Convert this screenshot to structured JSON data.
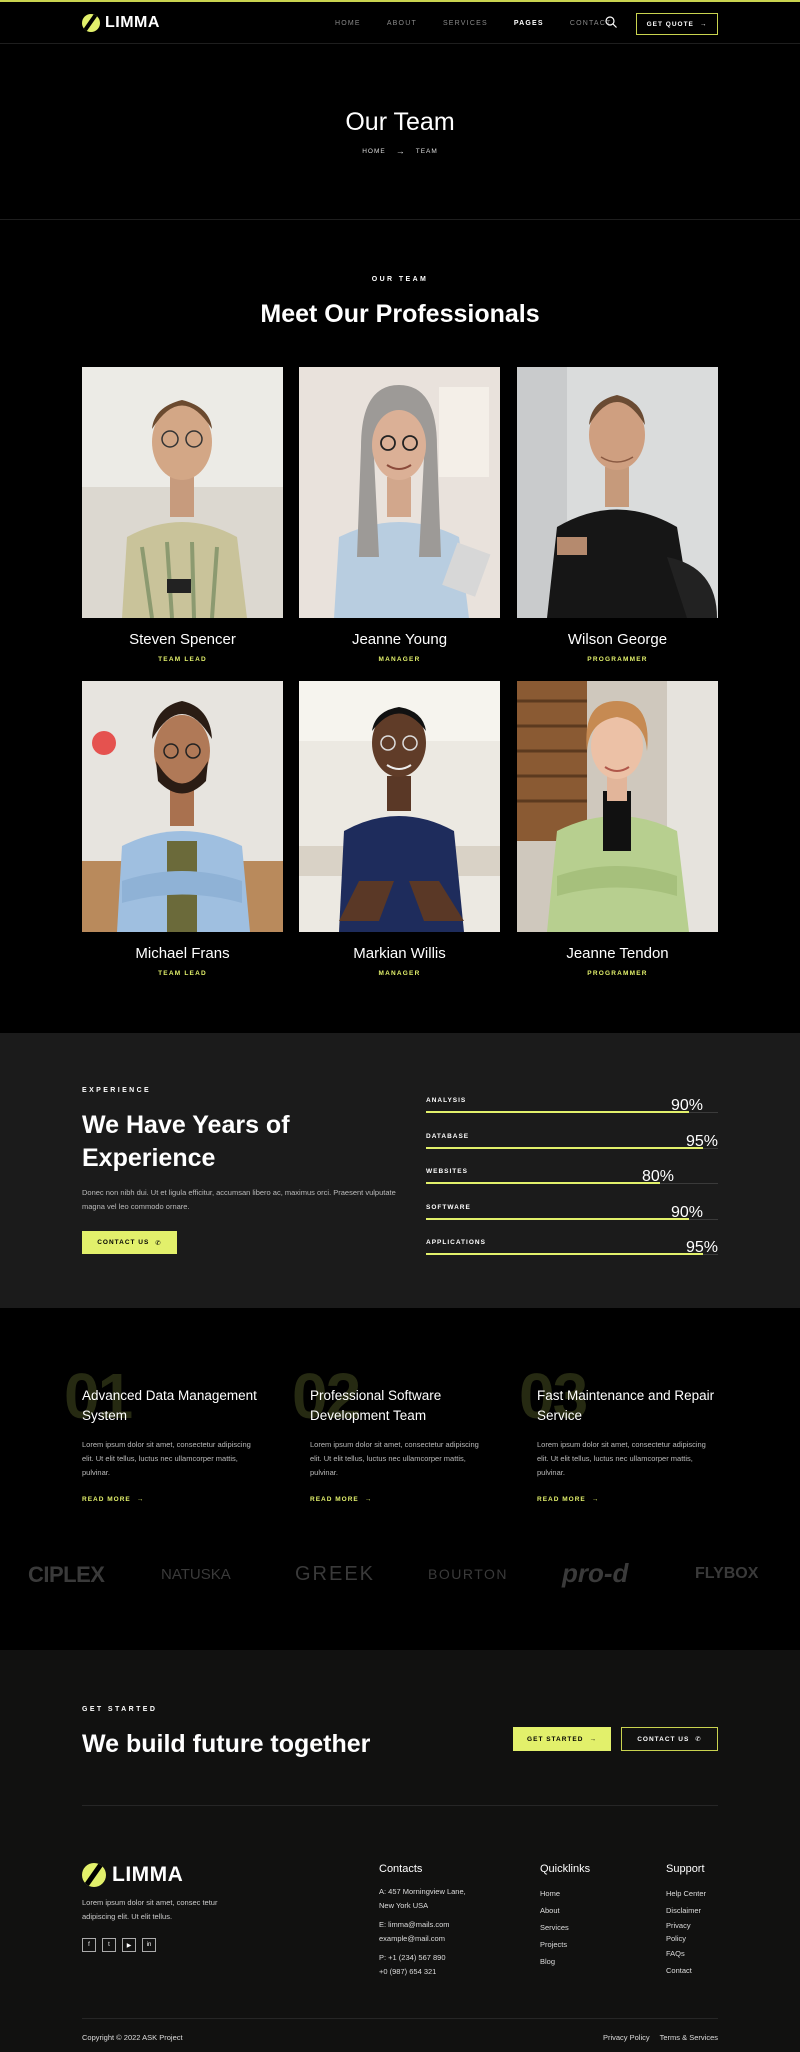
{
  "brand": {
    "name": "LIMMA",
    "accent": "#e2f06b"
  },
  "nav": {
    "items": [
      "HOME",
      "ABOUT",
      "SERVICES",
      "PAGES",
      "CONTACT"
    ],
    "active": "PAGES",
    "quote_label": "GET QUOTE"
  },
  "hero": {
    "title": "Our Team",
    "breadcrumb": [
      "HOME",
      "TEAM"
    ]
  },
  "team": {
    "eyebrow": "OUR TEAM",
    "title": "Meet Our Professionals",
    "members": [
      {
        "name": "Steven Spencer",
        "role": "TEAM LEAD"
      },
      {
        "name": "Jeanne Young",
        "role": "MANAGER"
      },
      {
        "name": "Wilson George",
        "role": "PROGRAMMER"
      },
      {
        "name": "Michael Frans",
        "role": "TEAM LEAD"
      },
      {
        "name": "Markian Willis",
        "role": "MANAGER"
      },
      {
        "name": "Jeanne Tendon",
        "role": "PROGRAMMER"
      }
    ]
  },
  "experience": {
    "eyebrow": "EXPERIENCE",
    "title": "We Have Years of Experience",
    "text": "Donec non nibh dui. Ut et ligula efficitur, accumsan libero ac, maximus orci. Praesent vulputate magna vel leo commodo ornare.",
    "button": "CONTACT US",
    "skills": [
      {
        "label": "ANALYSIS",
        "pct": "90%",
        "value": 90
      },
      {
        "label": "DATABASE",
        "pct": "95%",
        "value": 95
      },
      {
        "label": "WEBSITES",
        "pct": "80%",
        "value": 80
      },
      {
        "label": "SOFTWARE",
        "pct": "90%",
        "value": 90
      },
      {
        "label": "APPLICATIONS",
        "pct": "95%",
        "value": 95
      }
    ]
  },
  "services": [
    {
      "num": "01",
      "title": "Advanced Data Management System",
      "text": "Lorem ipsum dolor sit amet, consectetur adipiscing elit. Ut elit tellus, luctus nec ullamcorper mattis, pulvinar.",
      "link": "READ MORE"
    },
    {
      "num": "02",
      "title": "Professional Software Development Team",
      "text": "Lorem ipsum dolor sit amet, consectetur adipiscing elit. Ut elit tellus, luctus nec ullamcorper mattis, pulvinar.",
      "link": "READ MORE"
    },
    {
      "num": "03",
      "title": "Fast Maintenance and Repair Service",
      "text": "Lorem ipsum dolor sit amet, consectetur adipiscing elit. Ut elit tellus, luctus nec ullamcorper mattis, pulvinar.",
      "link": "READ MORE"
    }
  ],
  "partners": [
    "CIPLEX",
    "NATUSKA",
    "GREEK",
    "BOURTON",
    "pro-d",
    "FLYBOX"
  ],
  "cta": {
    "eyebrow": "GET STARTED",
    "title": "We build future together",
    "primary": "GET STARTED",
    "secondary": "CONTACT US"
  },
  "footer": {
    "about": "Lorem ipsum dolor sit amet, consec tetur adipiscing elit. Ut elit tellus.",
    "contacts_title": "Contacts",
    "address": [
      "A: 457 Morningview Lane,",
      "New York USA"
    ],
    "emails": [
      "E: limma@mails.com",
      "example@mail.com"
    ],
    "phones": [
      "P: +1 (234) 567 890",
      "+0 (987) 654 321"
    ],
    "quicklinks_title": "Quicklinks",
    "quicklinks": [
      "Home",
      "About",
      "Services",
      "Projects",
      "Blog"
    ],
    "support_title": "Support",
    "support": [
      "Help Center",
      "Disclaimer",
      "Privacy",
      "Policy",
      "FAQs",
      "Contact"
    ],
    "copyright": "Copyright © 2022 ASK Project",
    "legal": [
      "Privacy Policy",
      "Terms & Services"
    ],
    "socials": [
      "facebook-icon",
      "twitter-icon",
      "youtube-icon",
      "linkedin-icon"
    ]
  }
}
